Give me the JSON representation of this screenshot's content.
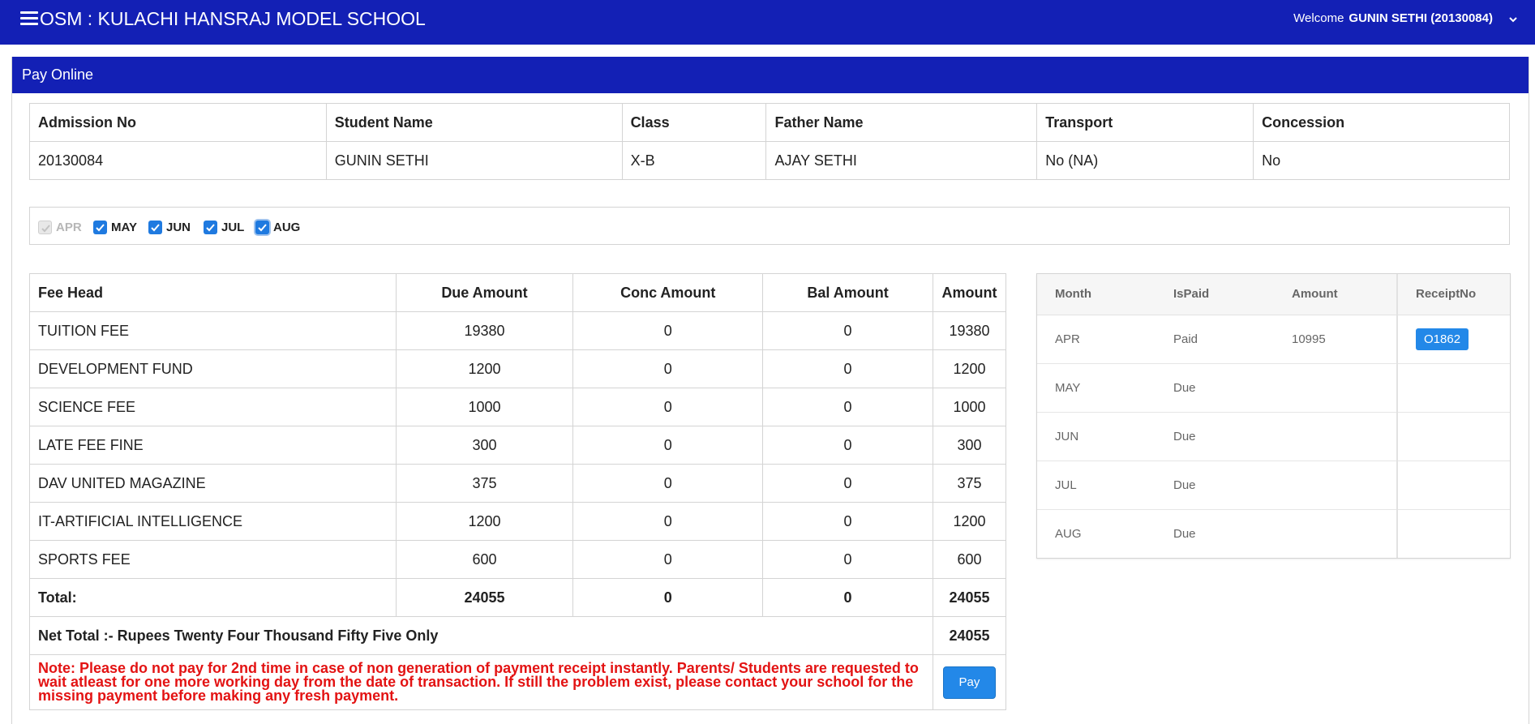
{
  "header": {
    "title": "OSM : KULACHI HANSRAJ MODEL SCHOOL",
    "welcome_label": "Welcome",
    "user": "GUNIN SETHI (20130084)",
    "menu_icon": "hamburger-icon",
    "caret_icon": "chevron-down-icon",
    "bg_color": "#1320b5"
  },
  "panel": {
    "title": "Pay Online"
  },
  "student": {
    "headers": [
      "Admission No",
      "Student Name",
      "Class",
      "Father Name",
      "Transport",
      "Concession"
    ],
    "values": [
      "20130084",
      "GUNIN SETHI",
      "X-B",
      "AJAY SETHI",
      "No (NA)",
      "No"
    ]
  },
  "months": [
    {
      "label": "APR",
      "checked": true,
      "disabled": true
    },
    {
      "label": "MAY",
      "checked": true,
      "disabled": false
    },
    {
      "label": "JUN",
      "checked": true,
      "disabled": false
    },
    {
      "label": "JUL",
      "checked": true,
      "disabled": false
    },
    {
      "label": "AUG",
      "checked": true,
      "disabled": false
    }
  ],
  "fees": {
    "headers": [
      "Fee Head",
      "Due Amount",
      "Conc Amount",
      "Bal Amount",
      "Amount"
    ],
    "rows": [
      [
        "TUITION FEE",
        "19380",
        "0",
        "0",
        "19380"
      ],
      [
        "DEVELOPMENT FUND",
        "1200",
        "0",
        "0",
        "1200"
      ],
      [
        "SCIENCE FEE",
        "1000",
        "0",
        "0",
        "1000"
      ],
      [
        "LATE FEE FINE",
        "300",
        "0",
        "0",
        "300"
      ],
      [
        "DAV UNITED MAGAZINE",
        "375",
        "0",
        "0",
        "375"
      ],
      [
        "IT-ARTIFICIAL INTELLIGENCE",
        "1200",
        "0",
        "0",
        "1200"
      ],
      [
        "SPORTS FEE",
        "600",
        "0",
        "0",
        "600"
      ]
    ],
    "total": [
      "Total:",
      "24055",
      "0",
      "0",
      "24055"
    ],
    "net_total_label": "Net Total :- Rupees Twenty Four Thousand Fifty Five Only",
    "net_total_value": "24055",
    "note": "Note: Please do not pay for 2nd time in case of non generation of payment receipt instantly. Parents/ Students are requested to wait atleast for one more working day from the date of transaction. If still the problem exist, please contact your school for the missing payment before making any fresh payment.",
    "pay_label": "Pay"
  },
  "receipts": {
    "headers": [
      "Month",
      "IsPaid",
      "Amount",
      "ReceiptNo"
    ],
    "rows": [
      {
        "month": "APR",
        "status": "Paid",
        "amount": "10995",
        "receipt": "O1862"
      },
      {
        "month": "MAY",
        "status": "Due",
        "amount": "",
        "receipt": ""
      },
      {
        "month": "JUN",
        "status": "Due",
        "amount": "",
        "receipt": ""
      },
      {
        "month": "JUL",
        "status": "Due",
        "amount": "",
        "receipt": ""
      },
      {
        "month": "AUG",
        "status": "Due",
        "amount": "",
        "receipt": ""
      }
    ]
  }
}
